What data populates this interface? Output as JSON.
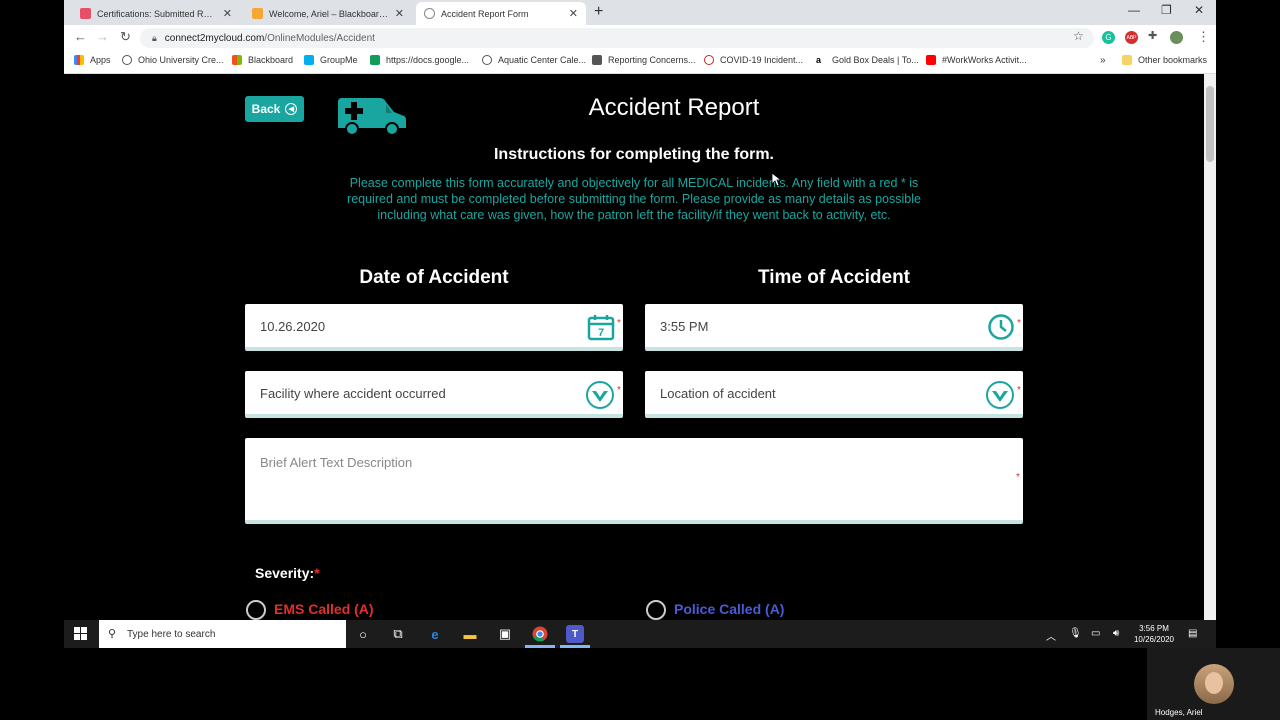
{
  "browser": {
    "tabs": [
      {
        "label": "Certifications: Submitted Rosters",
        "color": "#e94f64"
      },
      {
        "label": "Welcome, Ariel – Blackboard Lea",
        "color": "#f4a833"
      },
      {
        "label": "Accident Report Form",
        "color": "#888888"
      }
    ],
    "url_host": "connect2mycloud.com",
    "url_path": "/OnlineModules/Accident",
    "bookmarks": [
      "Apps",
      "Ohio University Cre...",
      "Blackboard",
      "GroupMe",
      "https://docs.google...",
      "Aquatic Center Cale...",
      "Reporting Concerns...",
      "COVID-19 Incident...",
      "Gold Box Deals | To...",
      "#WorkWorks Activit...",
      "Other bookmarks"
    ],
    "extensions": [
      "G",
      "ABP"
    ]
  },
  "page": {
    "back_label": "Back",
    "title": "Accident Report",
    "instructions_title": "Instructions for completing the form.",
    "instructions_text": "Please complete this form accurately and objectively for all MEDICAL incidents. Any field with a red * is required and must be completed before submitting the form. Please provide as many details as possible including what care was given, how the patron left the facility/if they went back to activity, etc.",
    "date_label": "Date of Accident",
    "time_label": "Time of Accident",
    "date_value": "10.26.2020",
    "time_value": "3:55 PM",
    "facility_placeholder": "Facility where accident occurred",
    "location_placeholder": "Location of accident",
    "description_placeholder": "Brief Alert Text Description",
    "required_mark": "*",
    "severity_label": "Severity:",
    "option_ems": "EMS Called (A)",
    "option_police": "Police Called (A)",
    "calendar_day": "7",
    "colors": {
      "accent": "#1aa6a0",
      "required": "#e0302b",
      "ems": "#e0302b",
      "police": "#4b5bd6"
    }
  },
  "taskbar": {
    "search_placeholder": "Type here to search",
    "time": "3:56 PM",
    "date": "10/26/2020"
  },
  "webcam": {
    "name": "Hodges, Ariel"
  }
}
